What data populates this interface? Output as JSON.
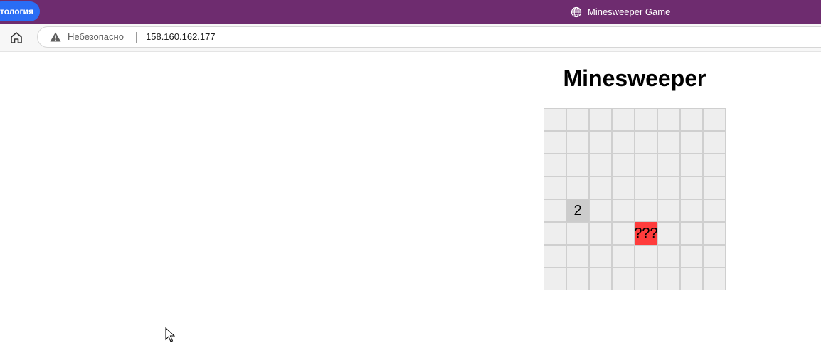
{
  "browser": {
    "tab_label": "тология",
    "window_title": "Minesweeper Game",
    "title_icon": "globe-icon",
    "home_icon": "home-icon",
    "security_icon": "warning-icon",
    "security_label": "Небезопасно",
    "url": "158.160.162.177",
    "colors": {
      "titlebar": "#6e2c6f",
      "tab_pill": "#2a6df5"
    }
  },
  "game": {
    "title": "Minesweeper",
    "rows": 8,
    "cols": 8,
    "cells": [
      [
        "",
        "",
        "",
        "",
        "",
        "",
        "",
        ""
      ],
      [
        "",
        "",
        "",
        "",
        "",
        "",
        "",
        ""
      ],
      [
        "",
        "",
        "",
        "",
        "",
        "",
        "",
        ""
      ],
      [
        "",
        "",
        "",
        "",
        "",
        "",
        "",
        ""
      ],
      [
        "",
        "2",
        "",
        "",
        "",
        "",
        "",
        ""
      ],
      [
        "",
        "",
        "",
        "",
        "???",
        "",
        "",
        ""
      ],
      [
        "",
        "",
        "",
        "",
        "",
        "",
        "",
        ""
      ],
      [
        "",
        "",
        "",
        "",
        "",
        "",
        "",
        ""
      ]
    ],
    "cell_states": [
      [
        "hidden",
        "hidden",
        "hidden",
        "hidden",
        "hidden",
        "hidden",
        "hidden",
        "hidden"
      ],
      [
        "hidden",
        "hidden",
        "hidden",
        "hidden",
        "hidden",
        "hidden",
        "hidden",
        "hidden"
      ],
      [
        "hidden",
        "hidden",
        "hidden",
        "hidden",
        "hidden",
        "hidden",
        "hidden",
        "hidden"
      ],
      [
        "hidden",
        "hidden",
        "hidden",
        "hidden",
        "hidden",
        "hidden",
        "hidden",
        "hidden"
      ],
      [
        "hidden",
        "revealed",
        "hidden",
        "hidden",
        "hidden",
        "hidden",
        "hidden",
        "hidden"
      ],
      [
        "hidden",
        "hidden",
        "hidden",
        "hidden",
        "mine",
        "hidden",
        "hidden",
        "hidden"
      ],
      [
        "hidden",
        "hidden",
        "hidden",
        "hidden",
        "hidden",
        "hidden",
        "hidden",
        "hidden"
      ],
      [
        "hidden",
        "hidden",
        "hidden",
        "hidden",
        "hidden",
        "hidden",
        "hidden",
        "hidden"
      ]
    ],
    "colors": {
      "hidden": "#eeeeee",
      "revealed": "#cccccc",
      "mine": "#ff3c3c"
    }
  },
  "cursor_icon": "mouse-pointer-icon"
}
